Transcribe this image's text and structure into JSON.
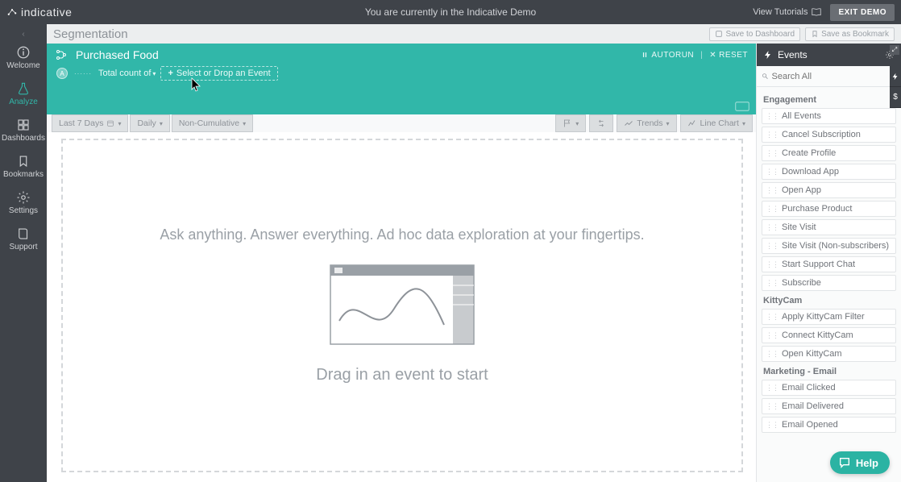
{
  "topbar": {
    "brand": "indicative",
    "demo_message": "You are currently in the Indicative Demo",
    "view_tutorials": "View Tutorials",
    "exit_demo": "EXIT DEMO"
  },
  "nav": {
    "items": [
      {
        "label": "Welcome",
        "icon": "info"
      },
      {
        "label": "Analyze",
        "icon": "flask"
      },
      {
        "label": "Dashboards",
        "icon": "grid"
      },
      {
        "label": "Bookmarks",
        "icon": "bookmark"
      },
      {
        "label": "Settings",
        "icon": "gear"
      },
      {
        "label": "Support",
        "icon": "book"
      }
    ]
  },
  "header": {
    "title": "Segmentation",
    "save_dashboard": "Save to Dashboard",
    "save_bookmark": "Save as Bookmark"
  },
  "query": {
    "name": "Purchased Food",
    "series_badge": "A",
    "total_count_label": "Total count of",
    "drop_hint": "Select or Drop an Event",
    "autorun": "AUTORUN",
    "reset": "RESET"
  },
  "toolbar": {
    "range": "Last 7 Days",
    "grain": "Daily",
    "mode": "Non-Cumulative",
    "trends": "Trends",
    "chart": "Line Chart"
  },
  "canvas": {
    "tagline": "Ask anything. Answer everything. Ad hoc data exploration at your fingertips.",
    "drop_hint": "Drag in an event to start"
  },
  "events": {
    "title": "Events",
    "search_placeholder": "Search All",
    "groups": [
      {
        "name": "Engagement",
        "items": [
          "All Events",
          "Cancel Subscription",
          "Create Profile",
          "Download App",
          "Open App",
          "Purchase Product",
          "Site Visit",
          "Site Visit (Non-subscribers)",
          "Start Support Chat",
          "Subscribe"
        ]
      },
      {
        "name": "KittyCam",
        "items": [
          "Apply KittyCam Filter",
          "Connect KittyCam",
          "Open KittyCam"
        ]
      },
      {
        "name": "Marketing - Email",
        "items": [
          "Email Clicked",
          "Email Delivered",
          "Email Opened"
        ]
      }
    ]
  },
  "help": {
    "label": "Help"
  }
}
